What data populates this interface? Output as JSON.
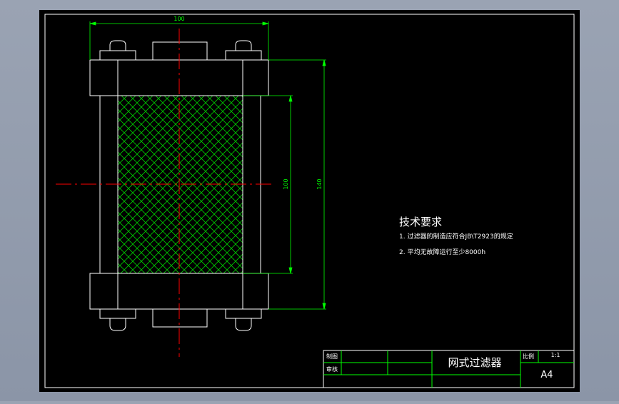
{
  "colors": {
    "background": "#000000",
    "line": "#ffffff",
    "dimension": "#00ff00",
    "centerline": "#ff0000",
    "hatch": "#00cc00",
    "frame_outer": "#ffffff"
  },
  "dimensions": {
    "width": "100",
    "inner_height": "100",
    "overall_height": "140"
  },
  "notes": {
    "heading": "技术要求",
    "line1": "1. 过滤器的制造应符合JB\\T2923的规定",
    "line2": "2. 平均无故障运行至少8000h"
  },
  "title_block": {
    "drawn_label": "制图",
    "checked_label": "审核",
    "part_name": "网式过滤器",
    "scale_label": "比例",
    "scale_value": "1:1",
    "sheet_size": "A4"
  }
}
